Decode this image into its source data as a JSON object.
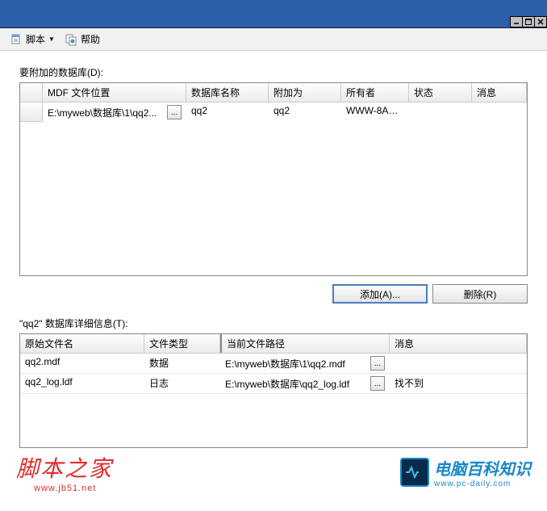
{
  "toolbar": {
    "script_label": "脚本",
    "help_label": "帮助"
  },
  "section1": {
    "label": "要附加的数据库(D):",
    "headers": {
      "mdf": "MDF 文件位置",
      "dbname": "数据库名称",
      "attach_as": "附加为",
      "owner": "所有者",
      "status": "状态",
      "message": "消息"
    },
    "row": {
      "mdf": "E:\\myweb\\数据库\\1\\qq2...",
      "dbname": "qq2",
      "attach_as": "qq2",
      "owner": "WWW-8AEF...",
      "status": "",
      "message": ""
    },
    "browse_btn": "..."
  },
  "buttons": {
    "add": "添加(A)...",
    "remove": "删除(R)"
  },
  "section2": {
    "label": "\"qq2\" 数据库详细信息(T):",
    "headers": {
      "orig_name": "原始文件名",
      "file_type": "文件类型",
      "cur_path": "当前文件路径",
      "message": "消息"
    },
    "rows": [
      {
        "orig_name": "qq2.mdf",
        "file_type": "数据",
        "cur_path": "E:\\myweb\\数据库\\1\\qq2.mdf",
        "message": ""
      },
      {
        "orig_name": "qq2_log.ldf",
        "file_type": "日志",
        "cur_path": "E:\\myweb\\数据库\\qq2_log.ldf",
        "message": "找不到"
      }
    ],
    "browse_btn": "..."
  },
  "watermarks": {
    "w1": "脚本之家",
    "w1_sub": "www.jb51.net",
    "w2": "电脑百科知识",
    "w2_sub": "www.pc-daily.com"
  }
}
